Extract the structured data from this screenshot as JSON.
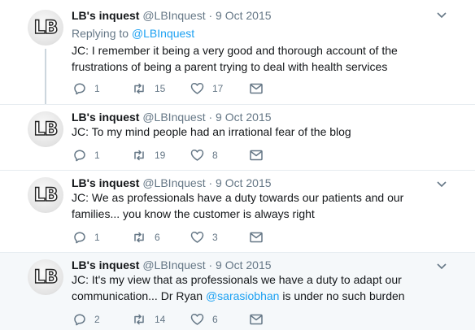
{
  "tweets": [
    {
      "name": "LB's inquest",
      "meta": "@LBInquest · 9 Oct 2015",
      "replying_prefix": "Replying to ",
      "replying_handle": "@LBInquest",
      "text": "JC: I remember it being a very good and thorough account of the frustrations of being a parent trying to deal with health services",
      "reply_count": "1",
      "retweet_count": "15",
      "like_count": "17"
    },
    {
      "name": "LB's inquest",
      "meta": "@LBInquest · 9 Oct 2015",
      "text": "JC: To my mind people had an irrational fear of the blog",
      "reply_count": "1",
      "retweet_count": "19",
      "like_count": "8"
    },
    {
      "name": "LB's inquest",
      "meta": "@LBInquest · 9 Oct 2015",
      "text": "JC: We as professionals have a duty towards our patients and our families... you know the customer is always right",
      "reply_count": "1",
      "retweet_count": "6",
      "like_count": "3"
    },
    {
      "name": "LB's inquest",
      "meta": "@LBInquest · 9 Oct 2015",
      "text_before": "JC: It's my view that as professionals we have a duty to adapt our communication... Dr Ryan ",
      "mention": "@sarasiobhan",
      "text_after": " is under no such burden",
      "reply_count": "2",
      "retweet_count": "14",
      "like_count": "6"
    }
  ],
  "avatar_text": "LB",
  "icons": {
    "reply": "reply-icon",
    "retweet": "retweet-icon",
    "like": "heart-icon",
    "dm": "envelope-icon",
    "menu": "chevron-down-icon"
  },
  "colors": {
    "text": "#14171a",
    "muted": "#657786",
    "link": "#1da1f2",
    "highlight_bg": "#f5f8fa"
  }
}
